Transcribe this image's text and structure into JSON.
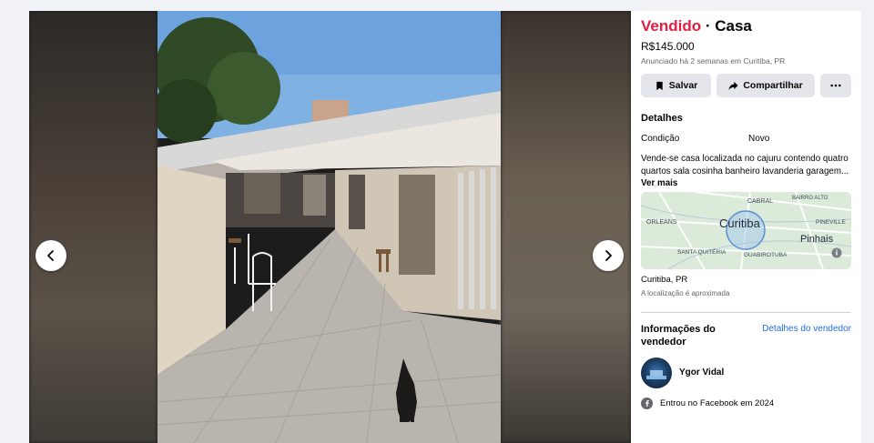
{
  "listing": {
    "status": "Vendido",
    "separator": " · ",
    "category": "Casa",
    "price": "R$145.000",
    "listed_info": "Anunciado há 2 semanas em Curitiba, PR"
  },
  "actions": {
    "save_label": "Salvar",
    "share_label": "Compartilhar"
  },
  "details": {
    "heading": "Detalhes",
    "condition_label": "Condição",
    "condition_value": "Novo",
    "description": "Vende-se casa localizada no cajuru contendo quatro quartos sala cosinha banheiro lavanderia garagem...",
    "see_more": "Ver mais"
  },
  "map": {
    "labels": [
      "CABRAL",
      "BAIRRO ALTO",
      "ORLEANS",
      "Curitiba",
      "PINEVILLE",
      "Pinhais",
      "SANTA QUITÉRIA",
      "GUABIROTUBA"
    ]
  },
  "location": {
    "city": "Curitiba, PR",
    "note": "A localização é aproximada"
  },
  "seller": {
    "heading": "Informações do vendedor",
    "details_link": "Detalhes do vendedor",
    "name": "Ygor Vidal",
    "joined": "Entrou no Facebook em 2024"
  },
  "colors": {
    "sold": "#e41e3f",
    "link": "#216fdb",
    "button_bg": "#e4e6eb"
  },
  "icons": {
    "prev": "chevron-left-icon",
    "next": "chevron-right-icon",
    "save": "bookmark-icon",
    "share": "share-arrow-icon",
    "more": "more-dots-icon",
    "info": "info-icon",
    "facebook": "facebook-icon"
  }
}
